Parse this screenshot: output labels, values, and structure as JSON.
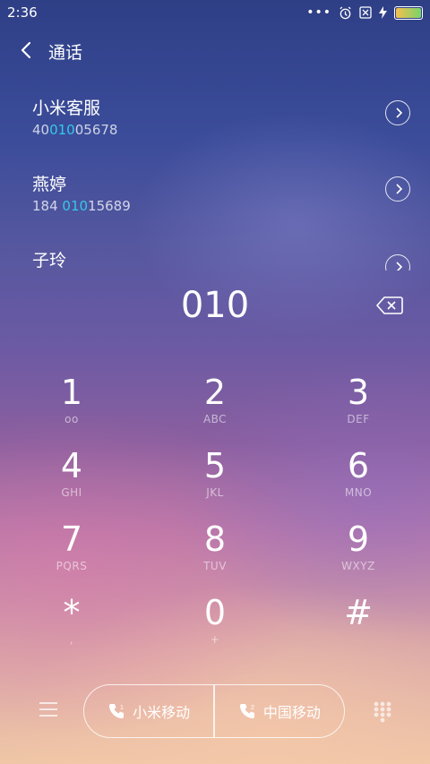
{
  "status_bar": {
    "time": "2:36",
    "more": "•••"
  },
  "header": {
    "title": "通话"
  },
  "results": [
    {
      "name": "小米客服",
      "num_pre": "40",
      "num_hl": "010",
      "num_post": "05678"
    },
    {
      "name": "燕婷",
      "num_pre": "184 ",
      "num_hl": "010",
      "num_post": "15689"
    },
    {
      "name": "子玲",
      "num_pre": "",
      "num_hl": "",
      "num_post": ""
    }
  ],
  "dial": {
    "digits": "010"
  },
  "keys": [
    {
      "num": "1",
      "sub": "oo"
    },
    {
      "num": "2",
      "sub": "ABC"
    },
    {
      "num": "3",
      "sub": "DEF"
    },
    {
      "num": "4",
      "sub": "GHI"
    },
    {
      "num": "5",
      "sub": "JKL"
    },
    {
      "num": "6",
      "sub": "MNO"
    },
    {
      "num": "7",
      "sub": "PQRS"
    },
    {
      "num": "8",
      "sub": "TUV"
    },
    {
      "num": "9",
      "sub": "WXYZ"
    },
    {
      "num": "*",
      "sub": ","
    },
    {
      "num": "0",
      "sub": "+"
    },
    {
      "num": "#",
      "sub": ""
    }
  ],
  "call_buttons": {
    "sim1_label": "小米移动",
    "sim2_label": "中国移动"
  },
  "colors": {
    "highlight": "#35c8e8"
  }
}
